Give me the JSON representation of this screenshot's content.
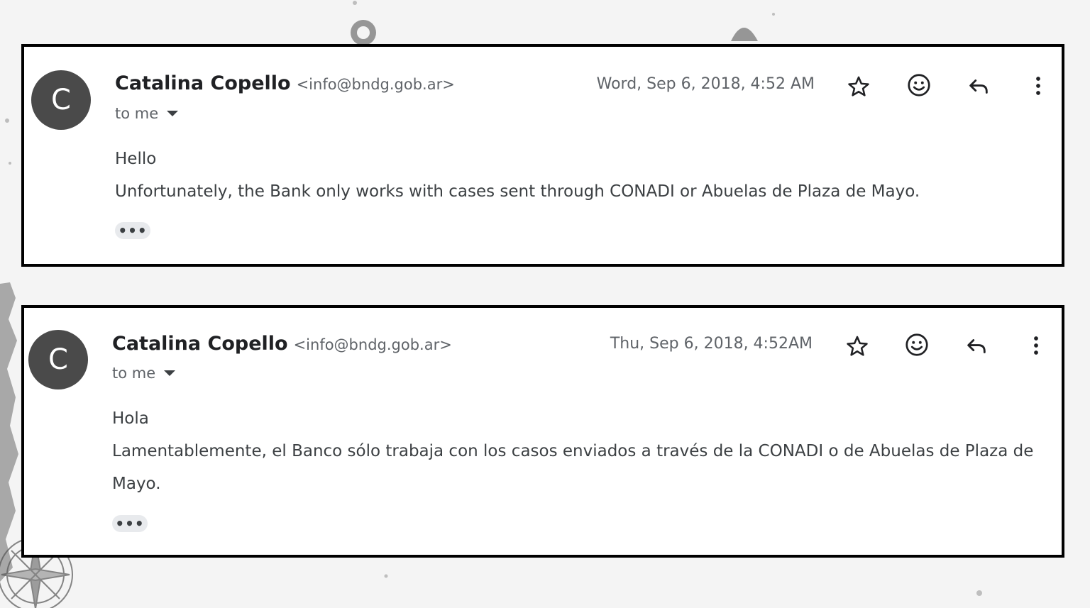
{
  "emails": [
    {
      "avatar_letter": "C",
      "sender_name": "Catalina Copello",
      "sender_email": "<info@bndg.gob.ar>",
      "date": "Word, Sep 6, 2018, 4:52 AM",
      "recipient": "to me",
      "greeting": "Hello",
      "body": "Unfortunately, the Bank only works with cases sent through CONADI or Abuelas de Plaza de Mayo.",
      "expand_label": "•••"
    },
    {
      "avatar_letter": "C",
      "sender_name": "Catalina Copello",
      "sender_email": "<info@bndg.gob.ar>",
      "date": "Thu, Sep 6, 2018, 4:52AM",
      "recipient": "to me",
      "greeting": "Hola",
      "body": "Lamentablemente, el Banco sólo trabaja con los casos enviados a través de la CONADI o de Abuelas de Plaza de Mayo.",
      "expand_label": "•••"
    }
  ],
  "icons": {
    "star": "star-icon",
    "emoji": "emoji-icon",
    "reply": "reply-icon",
    "more": "more-vert-icon"
  },
  "colors": {
    "avatar_bg": "#4a4a4a",
    "frame": "#000000",
    "background": "#f4f4f4"
  }
}
